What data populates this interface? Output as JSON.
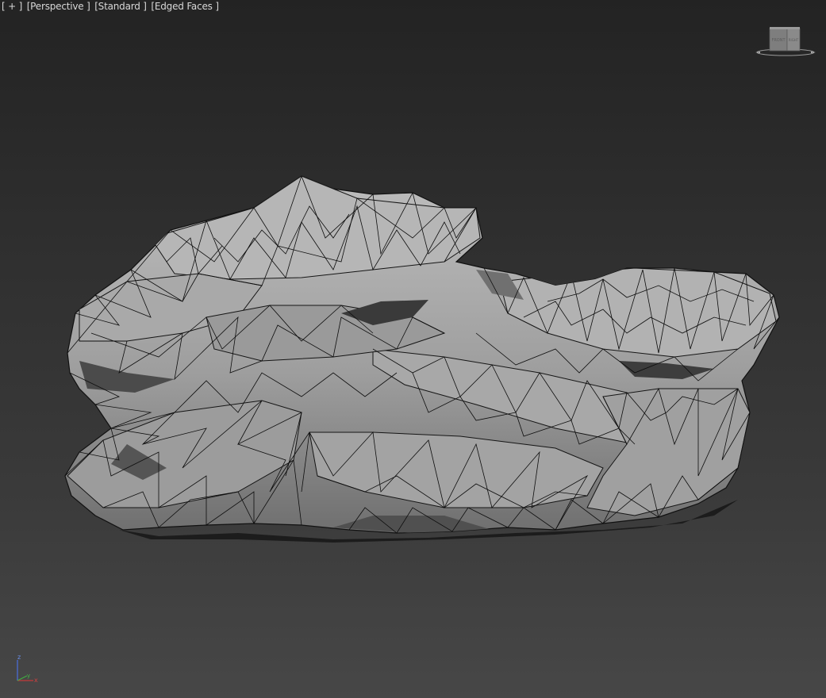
{
  "viewport": {
    "labels": [
      {
        "id": "menu",
        "text": "[ + ]"
      },
      {
        "id": "view",
        "text": "[Perspective ]"
      },
      {
        "id": "shading",
        "text": "[Standard ]"
      },
      {
        "id": "display",
        "text": "[Edged Faces ]"
      }
    ]
  },
  "viewcube": {
    "face_left": "FRONT",
    "face_right": "RIGHT"
  },
  "axis": {
    "z": "z",
    "x": "x",
    "y": "y"
  }
}
